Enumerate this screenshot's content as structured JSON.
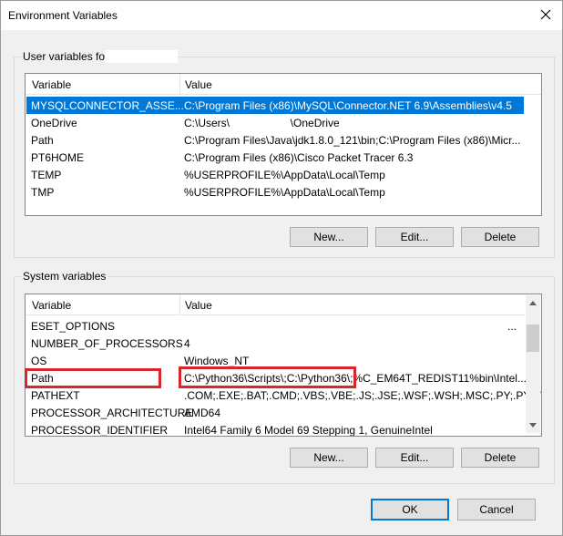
{
  "window": {
    "title": "Environment Variables"
  },
  "user_section": {
    "label": "User variables for",
    "columns": [
      "Variable",
      "Value"
    ],
    "rows": [
      {
        "variable": "MYSQLCONNECTOR_ASSE...",
        "value": "C:\\Program Files (x86)\\MySQL\\Connector.NET 6.9\\Assemblies\\v4.5",
        "selected": true
      },
      {
        "variable": "OneDrive",
        "value": "C:\\Users\\                    \\OneDrive"
      },
      {
        "variable": "Path",
        "value": "C:\\Program Files\\Java\\jdk1.8.0_121\\bin;C:\\Program Files (x86)\\Micr..."
      },
      {
        "variable": "PT6HOME",
        "value": "C:\\Program Files (x86)\\Cisco Packet Tracer 6.3"
      },
      {
        "variable": "TEMP",
        "value": "%USERPROFILE%\\AppData\\Local\\Temp"
      },
      {
        "variable": "TMP",
        "value": "%USERPROFILE%\\AppData\\Local\\Temp"
      }
    ],
    "buttons": {
      "new": "New...",
      "edit": "Edit...",
      "delete": "Delete"
    }
  },
  "system_section": {
    "label": "System variables",
    "columns": [
      "Variable",
      "Value"
    ],
    "rows": [
      {
        "variable": "ESET_OPTIONS",
        "value": "..."
      },
      {
        "variable": "NUMBER_OF_PROCESSORS",
        "value": "4"
      },
      {
        "variable": "OS",
        "value": "Windows_NT"
      },
      {
        "variable": "Path",
        "value": "C:\\Python36\\Scripts\\;C:\\Python36\\;%C_EM64T_REDIST11%bin\\Intel...",
        "highlighted": true
      },
      {
        "variable": "PATHEXT",
        "value": ".COM;.EXE;.BAT;.CMD;.VBS;.VBE;.JS;.JSE;.WSF;.WSH;.MSC;.PY;.PYW"
      },
      {
        "variable": "PROCESSOR_ARCHITECTURE",
        "value": "AMD64"
      },
      {
        "variable": "PROCESSOR_IDENTIFIER",
        "value": "Intel64 Family 6 Model 69 Stepping 1, GenuineIntel"
      }
    ],
    "buttons": {
      "new": "New...",
      "edit": "Edit...",
      "delete": "Delete"
    }
  },
  "footer": {
    "ok": "OK",
    "cancel": "Cancel"
  },
  "icons": {
    "close": "close-icon",
    "scroll_up": "chevron-up-icon",
    "scroll_down": "chevron-down-icon"
  },
  "colors": {
    "selection": "#0078d7",
    "highlight": "#d9262c",
    "default_button_border": "#0078d7"
  }
}
